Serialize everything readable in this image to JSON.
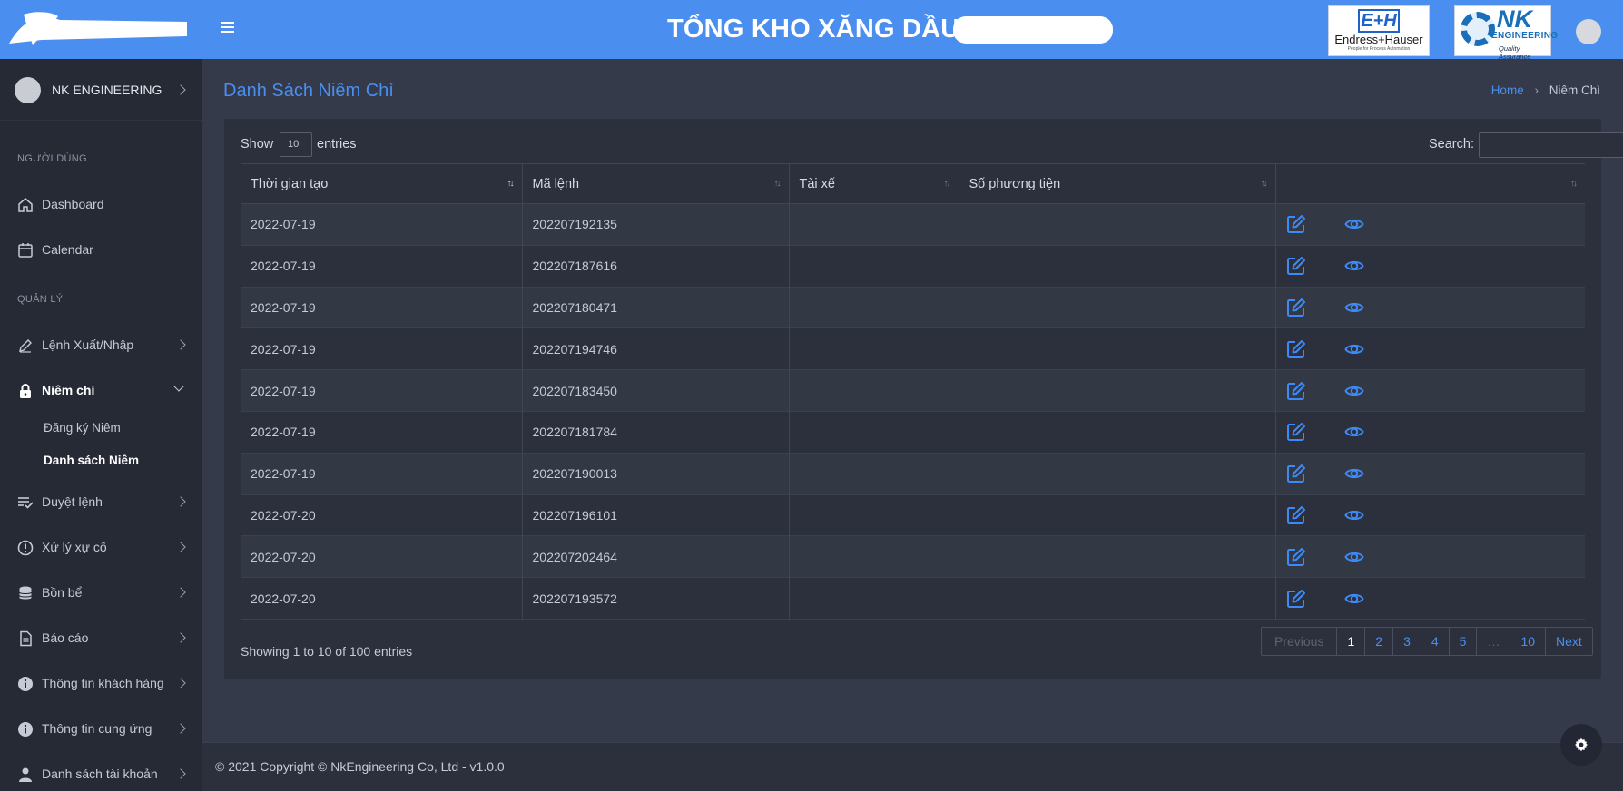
{
  "header": {
    "title": "TỔNG KHO XĂNG DẦU",
    "logos": {
      "endress": "Endress+Hauser",
      "endress_mark": "E+H",
      "endress_tagline": "People for Process Automation",
      "nk": "NK",
      "nk_sub": "ENGINEERING",
      "nk_tag": "Quality Assurance"
    }
  },
  "sidebar": {
    "user": "NK ENGINEERING",
    "sections": {
      "users": "NGƯỜI DÙNG",
      "manage": "QUẢN LÝ"
    },
    "items": {
      "dashboard": "Dashboard",
      "calendar": "Calendar",
      "lenh": "Lệnh Xuất/Nhập",
      "niemchi": "Niêm chì",
      "duyetlenh": "Duyệt lệnh",
      "xuly": "Xử lý xự cố",
      "bonbe": "Bồn bể",
      "baocao": "Báo cáo",
      "khachhang": "Thông tin khách hàng",
      "cungung": "Thông tin cung ứng",
      "taikhoan": "Danh sách tài khoản"
    },
    "sub": {
      "dangky": "Đăng ký Niêm",
      "danhsach": "Danh sách Niêm"
    }
  },
  "page": {
    "title": "Danh Sách Niêm Chì",
    "breadcrumb": {
      "home": "Home",
      "current": "Niêm Chì"
    }
  },
  "table_controls": {
    "show": "Show",
    "entries_value": "10",
    "entries": "entries",
    "search_label": "Search:",
    "search_value": ""
  },
  "table": {
    "columns": [
      "Thời gian tạo",
      "Mã lệnh",
      "Tài xế",
      "Số phương tiện",
      ""
    ],
    "rows": [
      {
        "date": "2022-07-19",
        "code": "202207192135",
        "driver": "",
        "vehicle": ""
      },
      {
        "date": "2022-07-19",
        "code": "202207187616",
        "driver": "",
        "vehicle": ""
      },
      {
        "date": "2022-07-19",
        "code": "202207180471",
        "driver": "",
        "vehicle": ""
      },
      {
        "date": "2022-07-19",
        "code": "202207194746",
        "driver": "",
        "vehicle": ""
      },
      {
        "date": "2022-07-19",
        "code": "202207183450",
        "driver": "",
        "vehicle": ""
      },
      {
        "date": "2022-07-19",
        "code": "202207181784",
        "driver": "",
        "vehicle": ""
      },
      {
        "date": "2022-07-19",
        "code": "202207190013",
        "driver": "",
        "vehicle": ""
      },
      {
        "date": "2022-07-20",
        "code": "202207196101",
        "driver": "",
        "vehicle": ""
      },
      {
        "date": "2022-07-20",
        "code": "202207202464",
        "driver": "",
        "vehicle": ""
      },
      {
        "date": "2022-07-20",
        "code": "202207193572",
        "driver": "",
        "vehicle": ""
      }
    ]
  },
  "pagination": {
    "info": "Showing 1 to 10 of 100 entries",
    "previous": "Previous",
    "pages": [
      "1",
      "2",
      "3",
      "4",
      "5",
      "…",
      "10"
    ],
    "next": "Next"
  },
  "footer": {
    "text": "© 2021 Copyright © NkEngineering Co, Ltd - v1.0.0"
  },
  "colors": {
    "accent": "#4a8ef0",
    "topbar": "#4a8ef0",
    "sidebar": "#262a35",
    "content": "#343a4a",
    "card": "#2b303c"
  },
  "icons": {
    "row_edit": "edit-icon",
    "row_view": "eye-icon",
    "fab": "gear-icon"
  }
}
